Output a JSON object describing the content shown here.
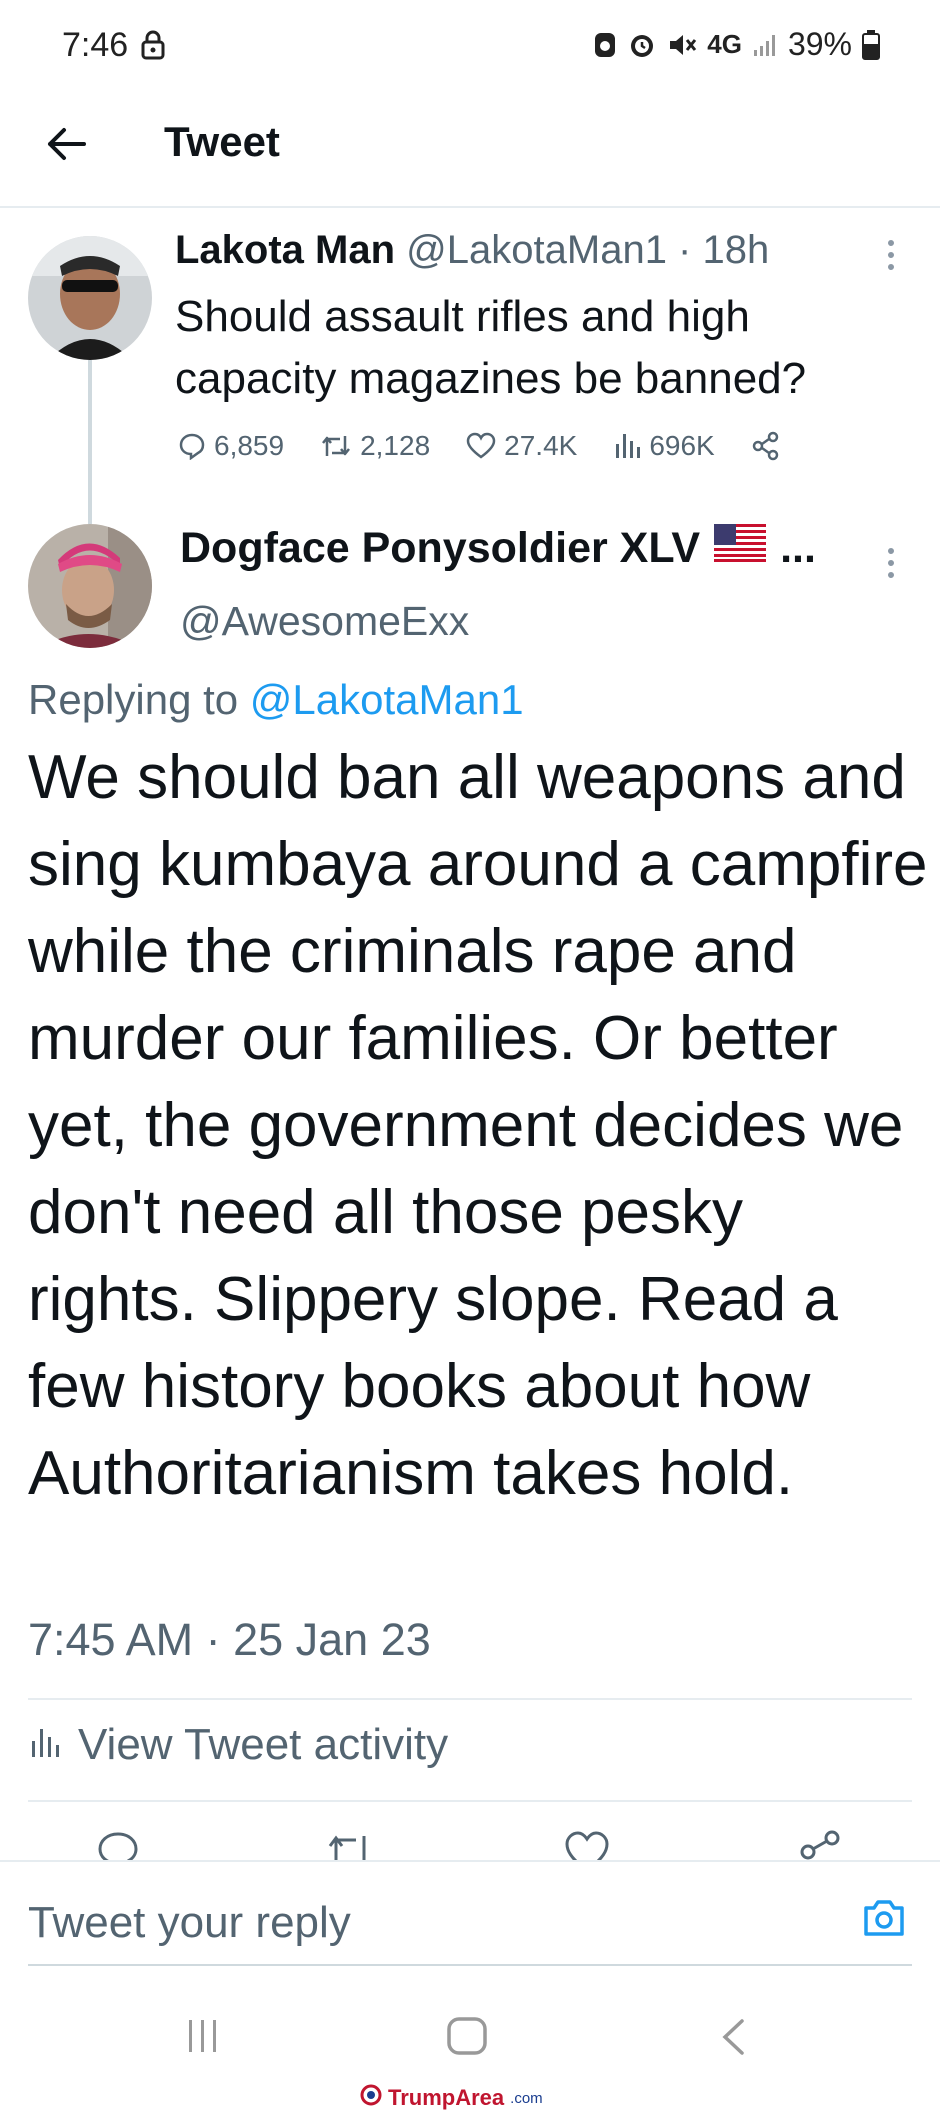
{
  "status_bar": {
    "time": "7:46",
    "network": "4G",
    "battery": "39%"
  },
  "header": {
    "title": "Tweet"
  },
  "original_tweet": {
    "author_name": "Lakota Man",
    "meta": "@LakotaMan1 · 18h",
    "text": "Should assault rifles and high capacity magazines be banned?",
    "stats": {
      "replies": "6,859",
      "retweets": "2,128",
      "likes": "27.4K",
      "views": "696K"
    }
  },
  "reply": {
    "author_name": "Dogface Ponysoldier XLV",
    "author_suffix": "...",
    "handle": "@AwesomeExx",
    "replying_prefix": "Replying to",
    "replying_mention": "@LakotaMan1",
    "text": "We should ban all weapons and sing kumbaya around a campfire while the criminals rape and murder our families. Or better yet, the government decides we don't need all those pesky rights. Slippery slope. Read a few history books about how Authoritarianism takes hold.",
    "timestamp": "7:45 AM · 25 Jan 23",
    "activity_label": "View Tweet activity"
  },
  "composer": {
    "placeholder": "Tweet your reply"
  },
  "watermark": {
    "brand": "TrumpArea",
    "domain": ".com"
  },
  "colors": {
    "accent": "#1d9bf0",
    "secondary_text": "#536471",
    "text": "#0f1419",
    "divider": "#e6ecf0"
  }
}
